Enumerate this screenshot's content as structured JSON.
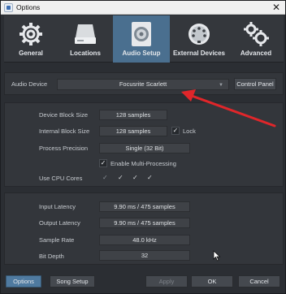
{
  "window": {
    "title": "Options",
    "close_glyph": "✕"
  },
  "tabs": [
    {
      "label": "General",
      "icon": "gear-icon",
      "active": false
    },
    {
      "label": "Locations",
      "icon": "drive-icon",
      "active": false
    },
    {
      "label": "Audio Setup",
      "icon": "speaker-icon",
      "active": true
    },
    {
      "label": "External Devices",
      "icon": "midi-connector-icon",
      "active": false
    },
    {
      "label": "Advanced",
      "icon": "gears-icon",
      "active": false
    }
  ],
  "audio_device": {
    "label": "Audio Device",
    "value": "Focusrite Scarlett",
    "control_panel": "Control Panel"
  },
  "settings": {
    "device_block_size": {
      "label": "Device Block Size",
      "value": "128 samples"
    },
    "internal_block_size": {
      "label": "Internal Block Size",
      "value": "128 samples"
    },
    "lock": {
      "label": "Lock",
      "checked": true
    },
    "process_precision": {
      "label": "Process Precision",
      "value": "Single (32 Bit)"
    },
    "multi_processing": {
      "label": "Enable Multi-Processing",
      "checked": true
    },
    "cpu_cores": {
      "label": "Use CPU Cores",
      "cores": [
        "✓",
        "✓",
        "✓",
        "✓"
      ]
    }
  },
  "info": {
    "input_latency": {
      "label": "Input Latency",
      "value": "9.90 ms / 475 samples"
    },
    "output_latency": {
      "label": "Output Latency",
      "value": "9.90 ms / 475 samples"
    },
    "sample_rate": {
      "label": "Sample Rate",
      "value": "48.0 kHz"
    },
    "bit_depth": {
      "label": "Bit Depth",
      "value": "32"
    }
  },
  "buttons": {
    "options": "Options",
    "song_setup": "Song Setup",
    "apply": "Apply",
    "ok": "OK",
    "cancel": "Cancel"
  },
  "colors": {
    "active_tab": "#4a6f8f",
    "annotation_arrow": "#e0262a",
    "primary_button": "#4f7aa0"
  }
}
